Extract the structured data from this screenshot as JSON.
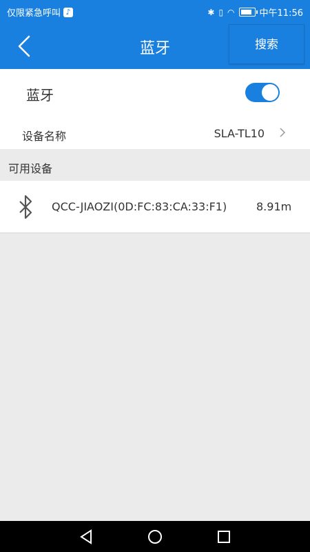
{
  "status_bar": {
    "left_text": "仅限紧急呼叫",
    "app_icon": "tiktok-icon",
    "time": "中午11:56",
    "icons": [
      "bluetooth-icon",
      "vibrate-icon",
      "wifi-icon",
      "battery-icon"
    ]
  },
  "app_bar": {
    "title": "蓝牙",
    "search_label": "搜索",
    "back_icon": "chevron-left-icon"
  },
  "bluetooth_row": {
    "label": "蓝牙",
    "enabled": true
  },
  "device_name_row": {
    "label": "设备名称",
    "value": "SLA-TL10"
  },
  "available_section": {
    "label": "可用设备"
  },
  "devices": [
    {
      "icon": "bluetooth-icon",
      "name": "QCC-JIAOZI(0D:FC:83:CA:33:F1)",
      "distance": "8.91m"
    }
  ],
  "nav_bar": {
    "buttons": [
      "back-triangle-icon",
      "home-circle-icon",
      "recents-square-icon"
    ]
  },
  "colors": {
    "primary": "#1a80df",
    "background": "#ebebeb"
  }
}
